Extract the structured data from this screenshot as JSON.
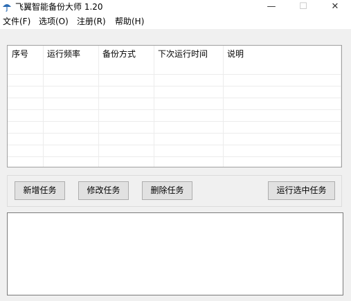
{
  "window": {
    "title": "飞翼智能备份大师 1.20",
    "controls": {
      "minimize": "—",
      "maximize": "☐",
      "close": "✕"
    }
  },
  "menu": [
    "文件(F)",
    "选项(O)",
    "注册(R)",
    "帮助(H)"
  ],
  "table": {
    "columns": [
      "序号",
      "运行频率",
      "备份方式",
      "下次运行时间",
      "说明"
    ],
    "rows": []
  },
  "buttons": {
    "add": "新增任务",
    "edit": "修改任务",
    "delete": "删除任务",
    "run": "运行选中任务"
  },
  "log": {
    "text": ""
  }
}
